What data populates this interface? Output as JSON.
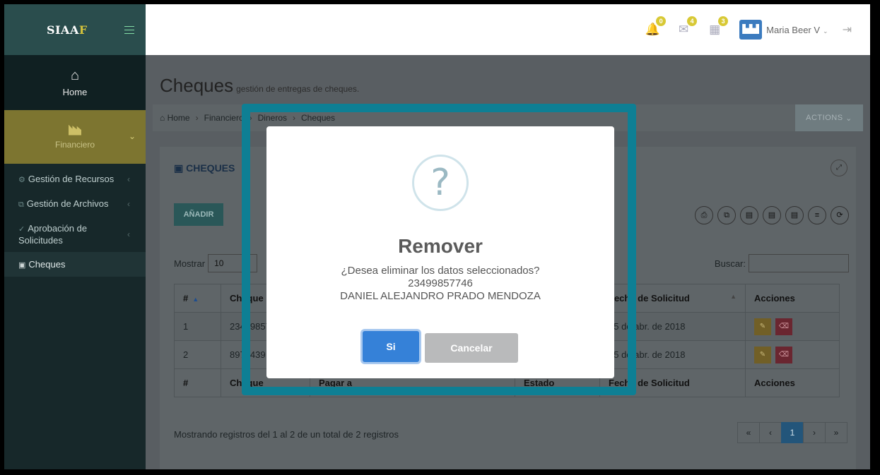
{
  "sidebar": {
    "brand_main": "SIAA",
    "brand_accent": "F",
    "home_label": "Home",
    "financiero_label": "Financiero",
    "items": [
      {
        "label": "Gestión de Recursos"
      },
      {
        "label": "Gestión de Archivos"
      },
      {
        "label": "Aprobación de Solicitudes"
      },
      {
        "label": "Cheques"
      }
    ]
  },
  "topbar": {
    "notifications_count": "0",
    "messages_count": "4",
    "tasks_count": "3",
    "user_name": "Maria Beer V"
  },
  "header": {
    "title": "Cheques",
    "subtitle": "gestión de entregas de cheques."
  },
  "breadcrumb": {
    "home": "Home",
    "financiero": "Financiero",
    "dineros": "Dineros",
    "cheques": "Cheques"
  },
  "actions_label": "ACTIONS",
  "panel": {
    "title": "CHEQUES",
    "add_label": "AÑADIR",
    "show_label": "Mostrar",
    "show_value": "10",
    "search_label": "Buscar:"
  },
  "table": {
    "headers": [
      "#",
      "Cheque",
      "Pagar a",
      "Estado",
      "Fecha de Solicitud",
      "Acciones"
    ],
    "rows": [
      {
        "num": "1",
        "cheque": "23499857746",
        "fecha": "25 de abr. de 2018"
      },
      {
        "num": "2",
        "cheque": "8974439",
        "fecha": "25 de abr. de 2018"
      }
    ]
  },
  "footer": {
    "info": "Mostrando registros del 1 al 2 de un total de 2 registros",
    "first": "«",
    "prev": "‹",
    "current_page": "1",
    "next": "›",
    "last": "»"
  },
  "modal": {
    "icon": "?",
    "title": "Remover",
    "question": "¿Desea eliminar los datos seleccionados?",
    "code": "23499857746",
    "name": "DANIEL ALEJANDRO PRADO MENDOZA",
    "confirm_label": "Si",
    "cancel_label": "Cancelar"
  },
  "colors": {
    "highlight": "#0e7f94",
    "confirm": "#3581d8",
    "brand_accent": "#d6c43b"
  }
}
